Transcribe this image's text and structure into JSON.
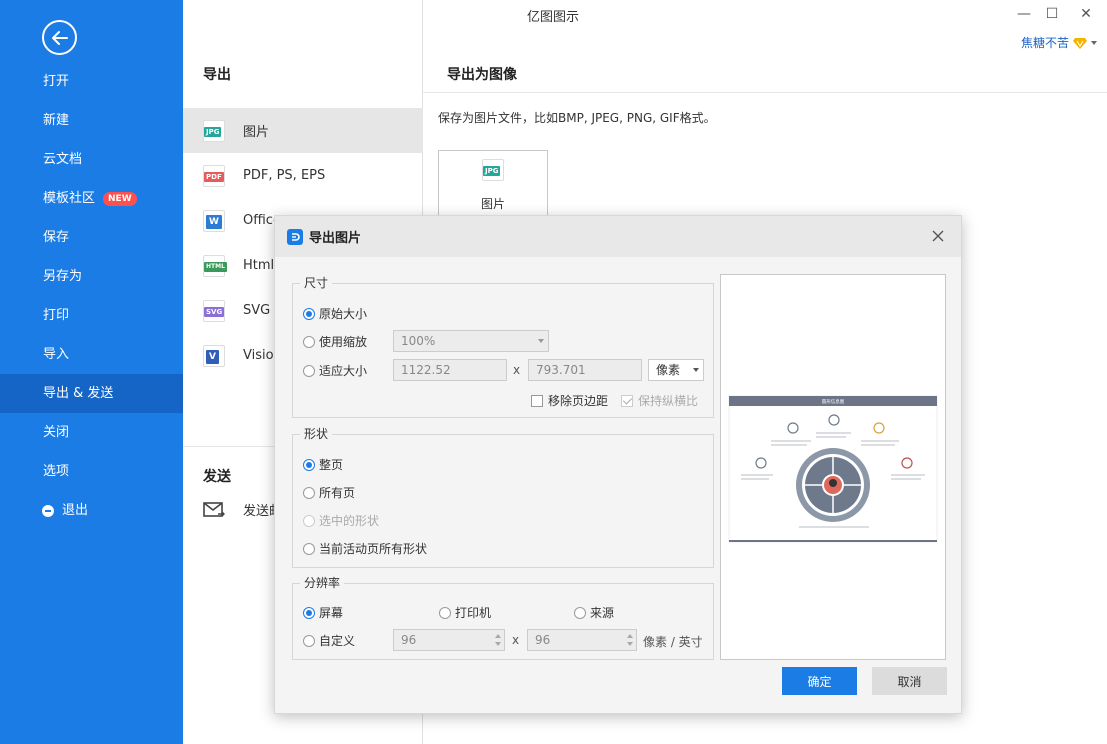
{
  "window": {
    "title": "亿图图示",
    "user": "焦糖不苦",
    "controls": {
      "minimize": "—",
      "maximize": "☐",
      "close": "✕"
    }
  },
  "sidebar": {
    "items": [
      {
        "label": "打开"
      },
      {
        "label": "新建"
      },
      {
        "label": "云文档"
      },
      {
        "label": "模板社区",
        "badge": "NEW"
      },
      {
        "label": "保存"
      },
      {
        "label": "另存为"
      },
      {
        "label": "打印"
      },
      {
        "label": "导入"
      },
      {
        "label": "导出 & 发送",
        "active": true
      },
      {
        "label": "关闭"
      },
      {
        "label": "选项"
      },
      {
        "label": "退出"
      }
    ],
    "colors": {
      "bg": "#1c7ce6",
      "active": "#1565c7",
      "badge": "#ff5050"
    }
  },
  "export_panel": {
    "heading": "导出",
    "formats": [
      {
        "icon_text": "JPG",
        "label": "图片",
        "color": "#26a69a"
      },
      {
        "icon_text": "PDF",
        "label": "PDF, PS, EPS",
        "color": "#e85b5b"
      },
      {
        "icon_text": "W",
        "label": "Office",
        "color": "#2b7cd3"
      },
      {
        "icon_text": "HTML",
        "label": "Html",
        "color": "#3a9a5b"
      },
      {
        "icon_text": "SVG",
        "label": "SVG",
        "color": "#8a6fd6"
      },
      {
        "icon_text": "V",
        "label": "Visio",
        "color": "#2f5fb8"
      }
    ],
    "send_heading": "发送",
    "send_label": "发送邮件"
  },
  "right": {
    "heading": "导出为图像",
    "description": "保存为图片文件，比如BMP, JPEG, PNG, GIF格式。",
    "card_icon_text": "JPG",
    "card_label": "图片"
  },
  "dialog": {
    "title": "导出图片",
    "size": {
      "title": "尺寸",
      "original": "原始大小",
      "use_zoom": "使用缩放",
      "zoom_value": "100%",
      "fit": "适应大小",
      "width": "1122.52",
      "x": "x",
      "height": "793.701",
      "unit": "像素",
      "remove_margin": "移除页边距",
      "keep_ratio": "保持纵横比"
    },
    "shape": {
      "title": "形状",
      "whole_page": "整页",
      "all_pages": "所有页",
      "selected": "选中的形状",
      "active_page": "当前活动页所有形状"
    },
    "resolution": {
      "title": "分辨率",
      "screen": "屏幕",
      "printer": "打印机",
      "source": "来源",
      "custom": "自定义",
      "dpi_x": "96",
      "x": "x",
      "dpi_y": "96",
      "unit": "像素 / 英寸"
    },
    "preview_title": "圆形信息图",
    "ok": "确定",
    "cancel": "取消"
  }
}
